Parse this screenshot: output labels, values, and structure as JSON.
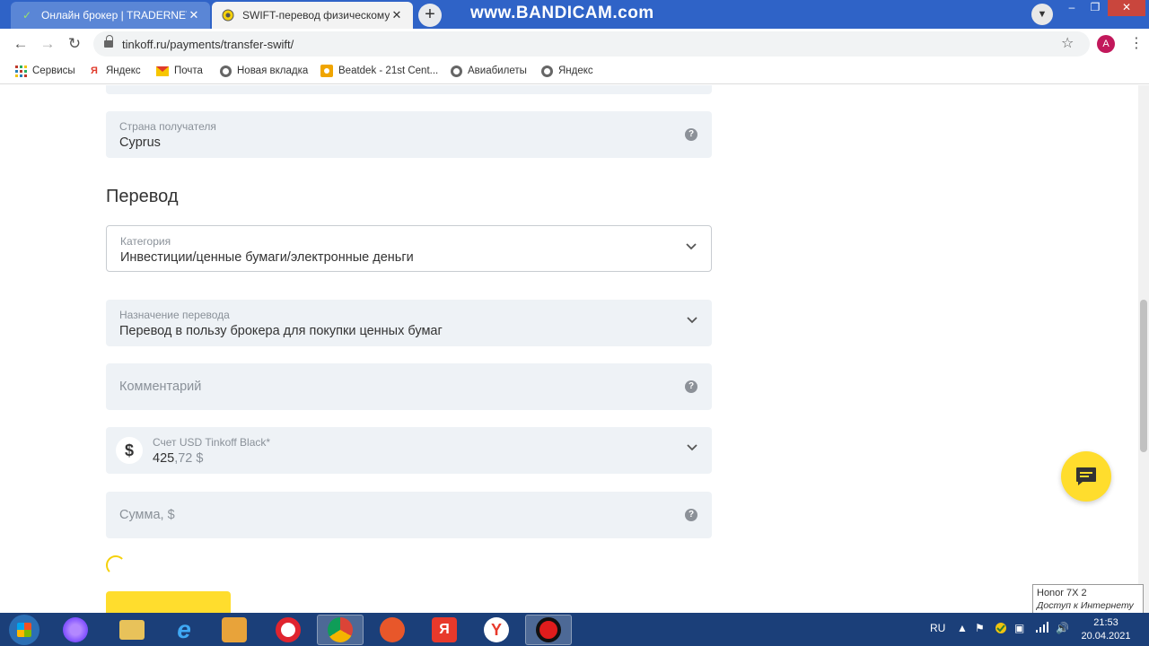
{
  "browser": {
    "tabs": [
      {
        "title": "Онлайн брокер | TRADERNET",
        "close": "✕"
      },
      {
        "title": "SWIFT-перевод физическому лицу",
        "close": "✕"
      }
    ],
    "new_tab": "+",
    "watermark": "www.BANDICAM.com",
    "window_controls": {
      "minimize": "–",
      "maximize": "❐",
      "close": "✕"
    },
    "nav": {
      "back": "←",
      "forward": "→",
      "reload": "↻"
    },
    "url": "tinkoff.ru/payments/transfer-swift/",
    "profile_initial": "А"
  },
  "bookmarks": [
    {
      "label": "Сервисы",
      "icon": "apps-grid-icon"
    },
    {
      "label": "Яндекс",
      "icon": "yandex-icon"
    },
    {
      "label": "Почта",
      "icon": "mail-icon"
    },
    {
      "label": "Новая вкладка",
      "icon": "globe-icon"
    },
    {
      "label": "Beatdek - 21st Cent...",
      "icon": "beatdek-icon"
    },
    {
      "label": "Авиабилеты",
      "icon": "globe-icon"
    },
    {
      "label": "Яндекс",
      "icon": "globe-icon"
    }
  ],
  "form": {
    "country": {
      "label": "Страна получателя",
      "value": "Cyprus"
    },
    "section_title": "Перевод",
    "category": {
      "label": "Категория",
      "value": "Инвестиции/ценные бумаги/электронные деньги"
    },
    "purpose": {
      "label": "Назначение перевода",
      "value": "Перевод в пользу брокера для покупки ценных бумаг"
    },
    "comment": {
      "placeholder": "Комментарий"
    },
    "account": {
      "label": "Счет USD Tinkoff Black*",
      "amount_int": "425",
      "amount_frac": ",72 $",
      "currency_symbol": "$"
    },
    "sum": {
      "placeholder": "Сумма, $"
    },
    "help_glyph": "?"
  },
  "notification": {
    "device": "Honor 7X  2",
    "status": "Доступ к Интернету"
  },
  "taskbar": {
    "lang": "RU",
    "time": "21:53",
    "date": "20.04.2021"
  },
  "colors": {
    "accent": "#ffdd2d",
    "field_bg": "#eef2f6",
    "tab_bar": "#2f63c7",
    "taskbar": "#1b3f79"
  }
}
